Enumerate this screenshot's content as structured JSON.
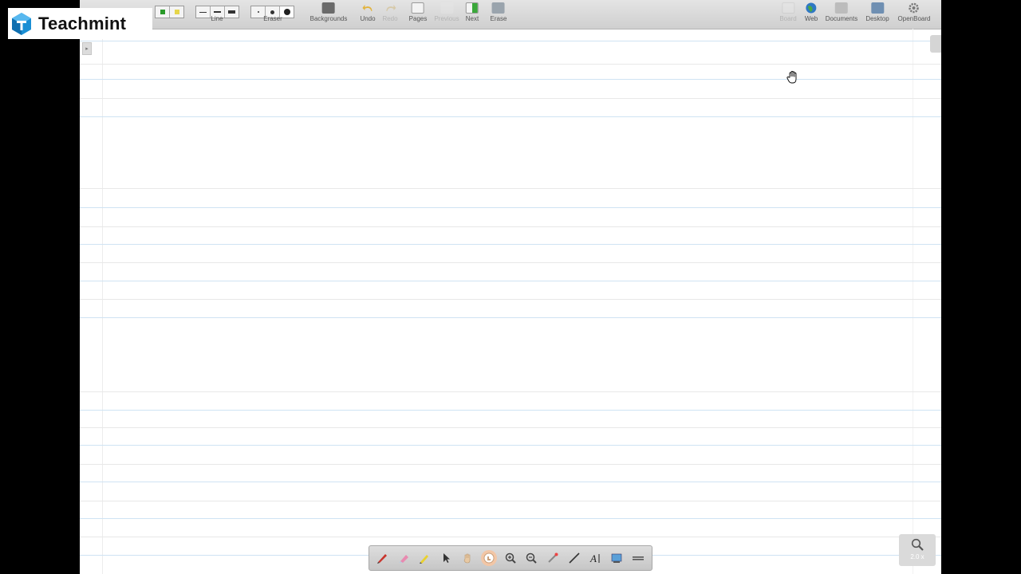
{
  "logo": {
    "brand": "Teachmint",
    "icon": "teachmint-logo-icon"
  },
  "toolbar": {
    "line_label": "Line",
    "eraser_label": "Eraser",
    "buttons": [
      {
        "id": "backgrounds",
        "label": "Backgrounds",
        "icon": "backgrounds-icon",
        "enabled": true
      },
      {
        "id": "undo",
        "label": "Undo",
        "icon": "undo-icon",
        "enabled": true
      },
      {
        "id": "redo",
        "label": "Redo",
        "icon": "redo-icon",
        "enabled": false
      },
      {
        "id": "pages",
        "label": "Pages",
        "icon": "pages-icon",
        "enabled": true
      },
      {
        "id": "previous",
        "label": "Previous",
        "icon": "previous-icon",
        "enabled": false
      },
      {
        "id": "next",
        "label": "Next",
        "icon": "next-icon",
        "enabled": true
      },
      {
        "id": "erase",
        "label": "Erase",
        "icon": "erase-icon",
        "enabled": true
      }
    ],
    "right_buttons": [
      {
        "id": "board",
        "label": "Board",
        "icon": "board-icon",
        "enabled": false
      },
      {
        "id": "web",
        "label": "Web",
        "icon": "globe-icon",
        "enabled": true
      },
      {
        "id": "documents",
        "label": "Documents",
        "icon": "folder-icon",
        "enabled": true
      },
      {
        "id": "desktop",
        "label": "Desktop",
        "icon": "desktop-icon",
        "enabled": true
      },
      {
        "id": "openboard",
        "label": "OpenBoard",
        "icon": "gear-icon",
        "enabled": true
      }
    ]
  },
  "palette": {
    "tools": [
      {
        "id": "pen",
        "icon": "pen-icon"
      },
      {
        "id": "eraser",
        "icon": "eraser-icon"
      },
      {
        "id": "marker",
        "icon": "marker-icon"
      },
      {
        "id": "selector",
        "icon": "pointer-icon"
      },
      {
        "id": "play",
        "icon": "hand-icon"
      },
      {
        "id": "interact",
        "icon": "interact-icon",
        "selected": true
      },
      {
        "id": "zoom-in",
        "icon": "zoom-in-icon"
      },
      {
        "id": "zoom-out",
        "icon": "zoom-out-icon"
      },
      {
        "id": "laser",
        "icon": "laser-pointer-icon"
      },
      {
        "id": "line",
        "icon": "line-icon"
      },
      {
        "id": "text",
        "icon": "text-icon"
      },
      {
        "id": "capture",
        "icon": "capture-icon"
      },
      {
        "id": "more",
        "icon": "menu-icon"
      }
    ]
  },
  "zoom": {
    "value": "2.0 x"
  },
  "colors": {
    "rule_blue": "#cfe3f3",
    "rule_gray": "#e8e8e8",
    "accent": "#f2c6a6"
  }
}
